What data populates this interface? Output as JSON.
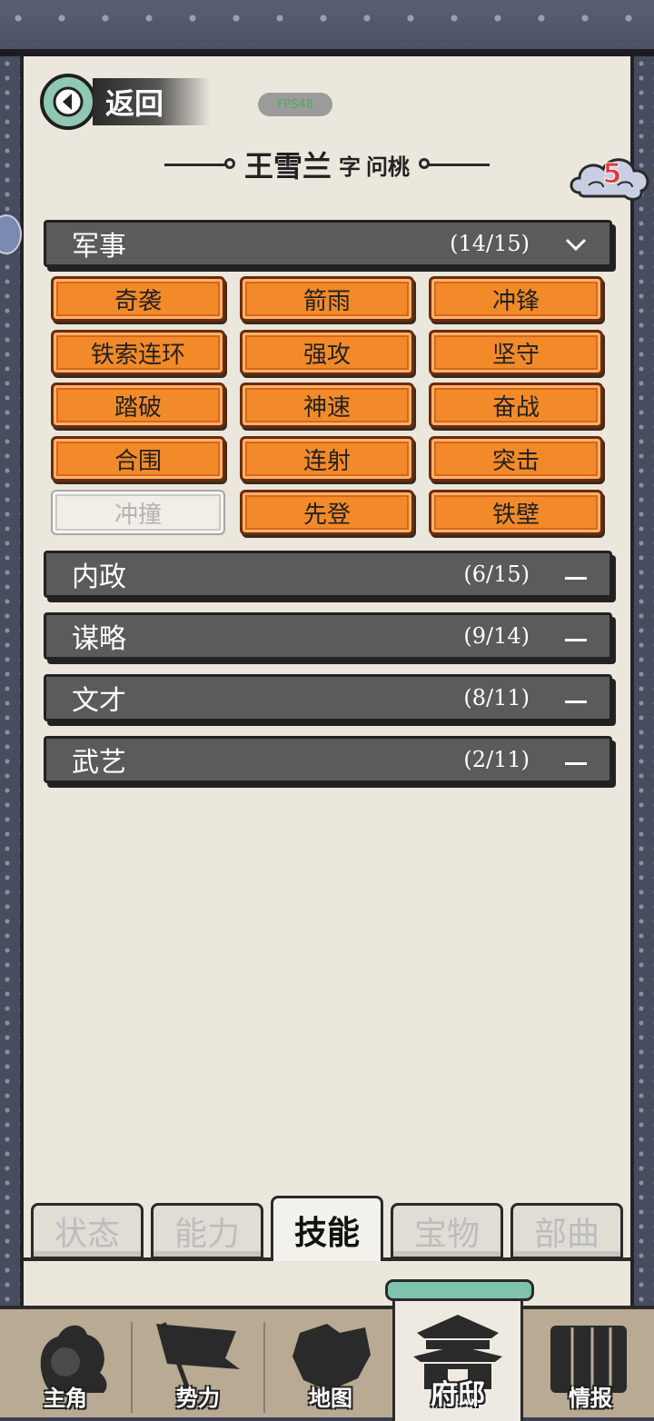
{
  "header": {
    "back_label": "返回",
    "fps_label": "FPS48",
    "name": "王雪兰",
    "zi_label": "字",
    "style_name": "问桃",
    "badge_count": "5"
  },
  "sections": [
    {
      "label": "军事",
      "count": "(14/15)",
      "expanded": true,
      "skills": [
        {
          "label": "奇袭",
          "learned": true
        },
        {
          "label": "箭雨",
          "learned": true
        },
        {
          "label": "冲锋",
          "learned": true
        },
        {
          "label": "铁索连环",
          "learned": true
        },
        {
          "label": "强攻",
          "learned": true
        },
        {
          "label": "坚守",
          "learned": true
        },
        {
          "label": "踏破",
          "learned": true
        },
        {
          "label": "神速",
          "learned": true
        },
        {
          "label": "奋战",
          "learned": true
        },
        {
          "label": "合围",
          "learned": true
        },
        {
          "label": "连射",
          "learned": true
        },
        {
          "label": "突击",
          "learned": true
        },
        {
          "label": "冲撞",
          "learned": false
        },
        {
          "label": "先登",
          "learned": true
        },
        {
          "label": "铁壁",
          "learned": true
        }
      ]
    },
    {
      "label": "内政",
      "count": "(6/15)",
      "expanded": false
    },
    {
      "label": "谋略",
      "count": "(9/14)",
      "expanded": false
    },
    {
      "label": "文才",
      "count": "(8/11)",
      "expanded": false
    },
    {
      "label": "武艺",
      "count": "(2/11)",
      "expanded": false
    }
  ],
  "subtabs": [
    {
      "label": "状态",
      "active": false
    },
    {
      "label": "能力",
      "active": false
    },
    {
      "label": "技能",
      "active": true
    },
    {
      "label": "宝物",
      "active": false
    },
    {
      "label": "部曲",
      "active": false
    }
  ],
  "bottom_nav": [
    {
      "label": "主角",
      "icon": "hero-icon",
      "active": false
    },
    {
      "label": "势力",
      "icon": "flag-icon",
      "active": false
    },
    {
      "label": "地图",
      "icon": "map-icon",
      "active": false
    },
    {
      "label": "府邸",
      "icon": "mansion-icon",
      "active": true
    },
    {
      "label": "情报",
      "icon": "scroll-icon",
      "active": false
    }
  ],
  "colors": {
    "skill_orange": "#f28a2a",
    "section_gray": "#5b5b5b",
    "paper": "#ebe7dd",
    "badge_red": "#e23b3b"
  }
}
